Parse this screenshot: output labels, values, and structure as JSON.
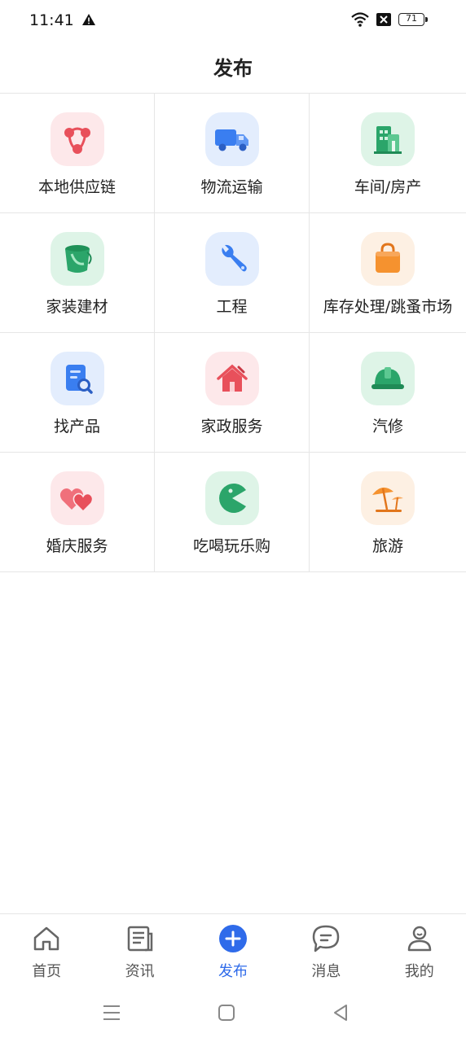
{
  "status": {
    "time": "11:41",
    "battery": "71"
  },
  "header": {
    "title": "发布"
  },
  "categories": [
    {
      "label": "本地供应链",
      "icon": "supply-chain-icon"
    },
    {
      "label": "物流运输",
      "icon": "truck-icon"
    },
    {
      "label": "车间/房产",
      "icon": "building-icon"
    },
    {
      "label": "家装建材",
      "icon": "paint-bucket-icon"
    },
    {
      "label": "工程",
      "icon": "wrench-icon"
    },
    {
      "label": "库存处理/跳蚤市场",
      "icon": "shopping-bag-icon"
    },
    {
      "label": "找产品",
      "icon": "document-search-icon"
    },
    {
      "label": "家政服务",
      "icon": "house-cleaning-icon"
    },
    {
      "label": "汽修",
      "icon": "hard-hat-icon"
    },
    {
      "label": "婚庆服务",
      "icon": "hearts-icon"
    },
    {
      "label": "吃喝玩乐购",
      "icon": "pacman-icon"
    },
    {
      "label": "旅游",
      "icon": "beach-umbrella-icon"
    }
  ],
  "bottom_nav": [
    {
      "label": "首页",
      "icon": "home-icon"
    },
    {
      "label": "资讯",
      "icon": "news-icon"
    },
    {
      "label": "发布",
      "icon": "plus-circle-icon",
      "active": true
    },
    {
      "label": "消息",
      "icon": "chat-icon"
    },
    {
      "label": "我的",
      "icon": "user-icon"
    }
  ],
  "colors": {
    "accent": "#2f6bea",
    "divider": "#e6e6e6"
  }
}
